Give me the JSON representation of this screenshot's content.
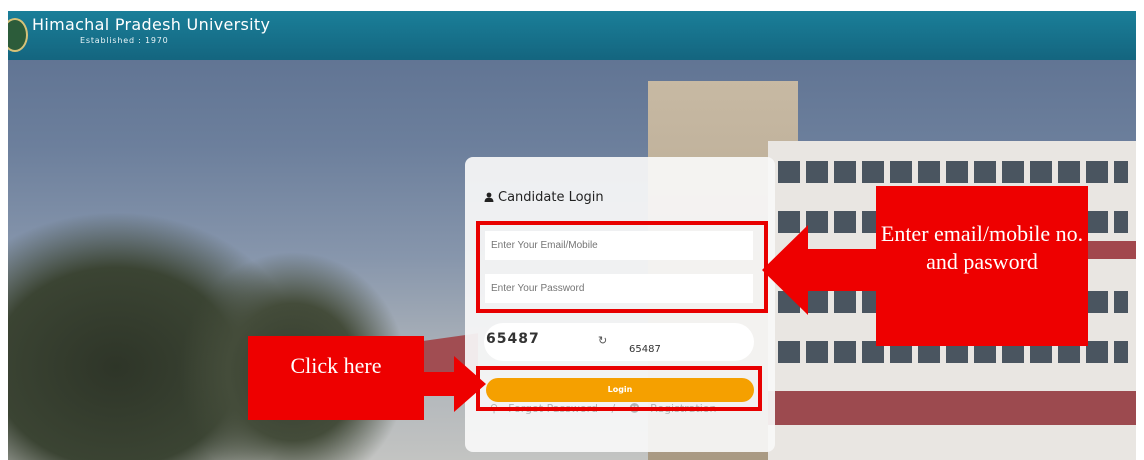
{
  "header": {
    "brand": "Himachal Pradesh University",
    "established": "Established : 1970"
  },
  "login": {
    "title": "Candidate Login",
    "email_placeholder": "Enter Your Email/Mobile",
    "password_placeholder": "Enter Your Password",
    "captcha_code": "65487",
    "captcha_input": "65487",
    "login_label": "Login",
    "forgot_label": "Forgot Password",
    "registration_label": "Registration"
  },
  "annotations": {
    "right_note": "Enter email/mobile no. and pasword",
    "left_note": "Click here"
  },
  "colors": {
    "header": "#14657f",
    "login_button": "#f5a000",
    "annotation": "#ee0000"
  },
  "icons": {
    "user": "user-icon",
    "refresh": "refresh-icon",
    "key": "key-icon",
    "registration": "user-plus-icon"
  }
}
